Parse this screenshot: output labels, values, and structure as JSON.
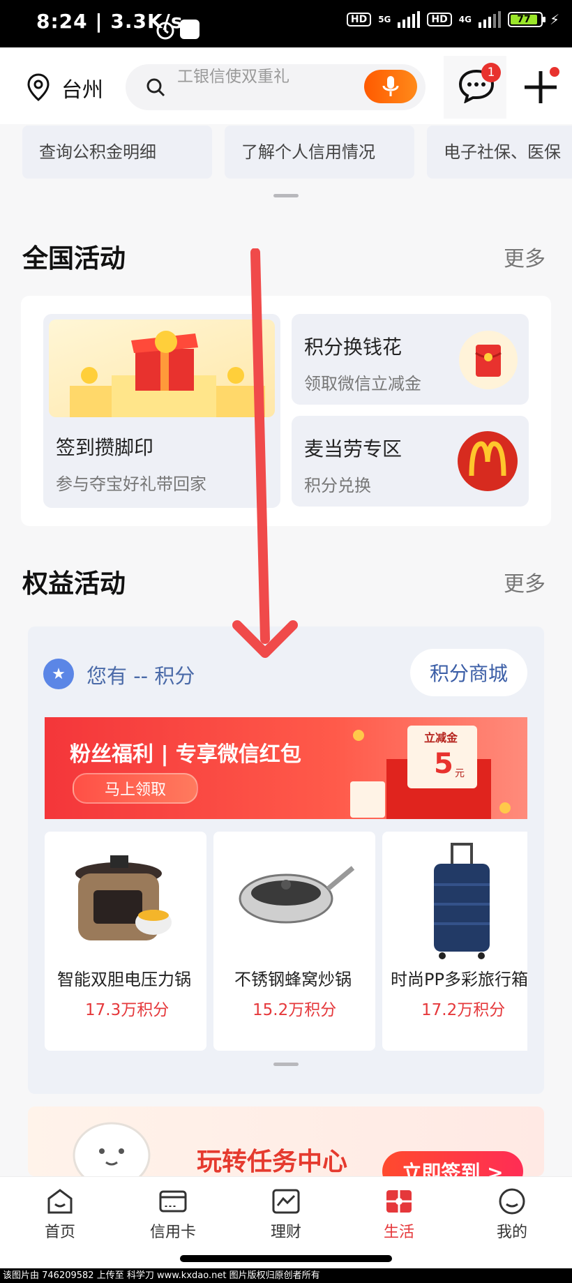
{
  "status_bar": {
    "time": "8:24 | 3.3K/s",
    "net_badge_1": "HD",
    "net_gen_1": "5G",
    "net_badge_2": "HD",
    "net_gen_2": "4G",
    "battery": "77"
  },
  "header": {
    "city": "台州",
    "search_placeholder": "工银信使双重礼",
    "message_badge": "1"
  },
  "quick_services": [
    "查询公积金明细",
    "了解个人信用情况",
    "电子社保、医保"
  ],
  "national": {
    "title": "全国活动",
    "more": "更多",
    "signin": {
      "title": "签到攒脚印",
      "subtitle": "参与夺宝好礼带回家"
    },
    "points_cash": {
      "title": "积分换钱花",
      "subtitle": "领取微信立减金"
    },
    "mcd": {
      "title": "麦当劳专区",
      "subtitle": "积分兑换"
    }
  },
  "rights": {
    "title": "权益活动",
    "more": "更多",
    "points_text": "您有 -- 积分",
    "mall_button": "积分商城",
    "banner": {
      "title": "粉丝福利 | 专享微信红包",
      "button": "马上领取",
      "coupon_title": "立减金",
      "coupon_value": "5",
      "coupon_unit": "元"
    },
    "products": [
      {
        "name": "智能双胆电压力锅",
        "price": "17.3万积分"
      },
      {
        "name": "不锈钢蜂窝炒锅",
        "price": "15.2万积分"
      },
      {
        "name": "时尚PP多彩旅行箱",
        "price": "17.2万积分"
      }
    ]
  },
  "task": {
    "title": "玩转任务中心",
    "button": "立即签到 >"
  },
  "tabs": [
    {
      "label": "首页",
      "icon": "home-icon"
    },
    {
      "label": "信用卡",
      "icon": "credit-card-icon"
    },
    {
      "label": "理财",
      "icon": "chart-icon"
    },
    {
      "label": "生活",
      "icon": "life-icon",
      "active": true
    },
    {
      "label": "我的",
      "icon": "profile-icon"
    }
  ],
  "footer": "该图片由 746209582 上传至 科学刀 www.kxdao.net 图片版权归原创者所有",
  "colors": {
    "accent": "#e5383b",
    "brand_orange": "#ff6a00",
    "link_blue": "#3a5da6"
  }
}
